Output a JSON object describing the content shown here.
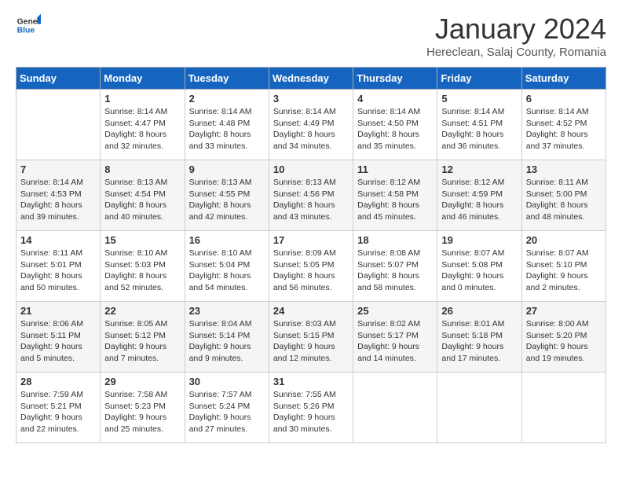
{
  "logo": {
    "general": "General",
    "blue": "Blue"
  },
  "title": "January 2024",
  "subtitle": "Hereclean, Salaj County, Romania",
  "days_of_week": [
    "Sunday",
    "Monday",
    "Tuesday",
    "Wednesday",
    "Thursday",
    "Friday",
    "Saturday"
  ],
  "weeks": [
    [
      {
        "day": null
      },
      {
        "day": "1",
        "sunrise": "8:14 AM",
        "sunset": "4:47 PM",
        "daylight": "8 hours and 32 minutes."
      },
      {
        "day": "2",
        "sunrise": "8:14 AM",
        "sunset": "4:48 PM",
        "daylight": "8 hours and 33 minutes."
      },
      {
        "day": "3",
        "sunrise": "8:14 AM",
        "sunset": "4:49 PM",
        "daylight": "8 hours and 34 minutes."
      },
      {
        "day": "4",
        "sunrise": "8:14 AM",
        "sunset": "4:50 PM",
        "daylight": "8 hours and 35 minutes."
      },
      {
        "day": "5",
        "sunrise": "8:14 AM",
        "sunset": "4:51 PM",
        "daylight": "8 hours and 36 minutes."
      },
      {
        "day": "6",
        "sunrise": "8:14 AM",
        "sunset": "4:52 PM",
        "daylight": "8 hours and 37 minutes."
      }
    ],
    [
      {
        "day": "7",
        "sunrise": "8:14 AM",
        "sunset": "4:53 PM",
        "daylight": "8 hours and 39 minutes."
      },
      {
        "day": "8",
        "sunrise": "8:13 AM",
        "sunset": "4:54 PM",
        "daylight": "8 hours and 40 minutes."
      },
      {
        "day": "9",
        "sunrise": "8:13 AM",
        "sunset": "4:55 PM",
        "daylight": "8 hours and 42 minutes."
      },
      {
        "day": "10",
        "sunrise": "8:13 AM",
        "sunset": "4:56 PM",
        "daylight": "8 hours and 43 minutes."
      },
      {
        "day": "11",
        "sunrise": "8:12 AM",
        "sunset": "4:58 PM",
        "daylight": "8 hours and 45 minutes."
      },
      {
        "day": "12",
        "sunrise": "8:12 AM",
        "sunset": "4:59 PM",
        "daylight": "8 hours and 46 minutes."
      },
      {
        "day": "13",
        "sunrise": "8:11 AM",
        "sunset": "5:00 PM",
        "daylight": "8 hours and 48 minutes."
      }
    ],
    [
      {
        "day": "14",
        "sunrise": "8:11 AM",
        "sunset": "5:01 PM",
        "daylight": "8 hours and 50 minutes."
      },
      {
        "day": "15",
        "sunrise": "8:10 AM",
        "sunset": "5:03 PM",
        "daylight": "8 hours and 52 minutes."
      },
      {
        "day": "16",
        "sunrise": "8:10 AM",
        "sunset": "5:04 PM",
        "daylight": "8 hours and 54 minutes."
      },
      {
        "day": "17",
        "sunrise": "8:09 AM",
        "sunset": "5:05 PM",
        "daylight": "8 hours and 56 minutes."
      },
      {
        "day": "18",
        "sunrise": "8:08 AM",
        "sunset": "5:07 PM",
        "daylight": "8 hours and 58 minutes."
      },
      {
        "day": "19",
        "sunrise": "8:07 AM",
        "sunset": "5:08 PM",
        "daylight": "9 hours and 0 minutes."
      },
      {
        "day": "20",
        "sunrise": "8:07 AM",
        "sunset": "5:10 PM",
        "daylight": "9 hours and 2 minutes."
      }
    ],
    [
      {
        "day": "21",
        "sunrise": "8:06 AM",
        "sunset": "5:11 PM",
        "daylight": "9 hours and 5 minutes."
      },
      {
        "day": "22",
        "sunrise": "8:05 AM",
        "sunset": "5:12 PM",
        "daylight": "9 hours and 7 minutes."
      },
      {
        "day": "23",
        "sunrise": "8:04 AM",
        "sunset": "5:14 PM",
        "daylight": "9 hours and 9 minutes."
      },
      {
        "day": "24",
        "sunrise": "8:03 AM",
        "sunset": "5:15 PM",
        "daylight": "9 hours and 12 minutes."
      },
      {
        "day": "25",
        "sunrise": "8:02 AM",
        "sunset": "5:17 PM",
        "daylight": "9 hours and 14 minutes."
      },
      {
        "day": "26",
        "sunrise": "8:01 AM",
        "sunset": "5:18 PM",
        "daylight": "9 hours and 17 minutes."
      },
      {
        "day": "27",
        "sunrise": "8:00 AM",
        "sunset": "5:20 PM",
        "daylight": "9 hours and 19 minutes."
      }
    ],
    [
      {
        "day": "28",
        "sunrise": "7:59 AM",
        "sunset": "5:21 PM",
        "daylight": "9 hours and 22 minutes."
      },
      {
        "day": "29",
        "sunrise": "7:58 AM",
        "sunset": "5:23 PM",
        "daylight": "9 hours and 25 minutes."
      },
      {
        "day": "30",
        "sunrise": "7:57 AM",
        "sunset": "5:24 PM",
        "daylight": "9 hours and 27 minutes."
      },
      {
        "day": "31",
        "sunrise": "7:55 AM",
        "sunset": "5:26 PM",
        "daylight": "9 hours and 30 minutes."
      },
      {
        "day": null
      },
      {
        "day": null
      },
      {
        "day": null
      }
    ]
  ]
}
